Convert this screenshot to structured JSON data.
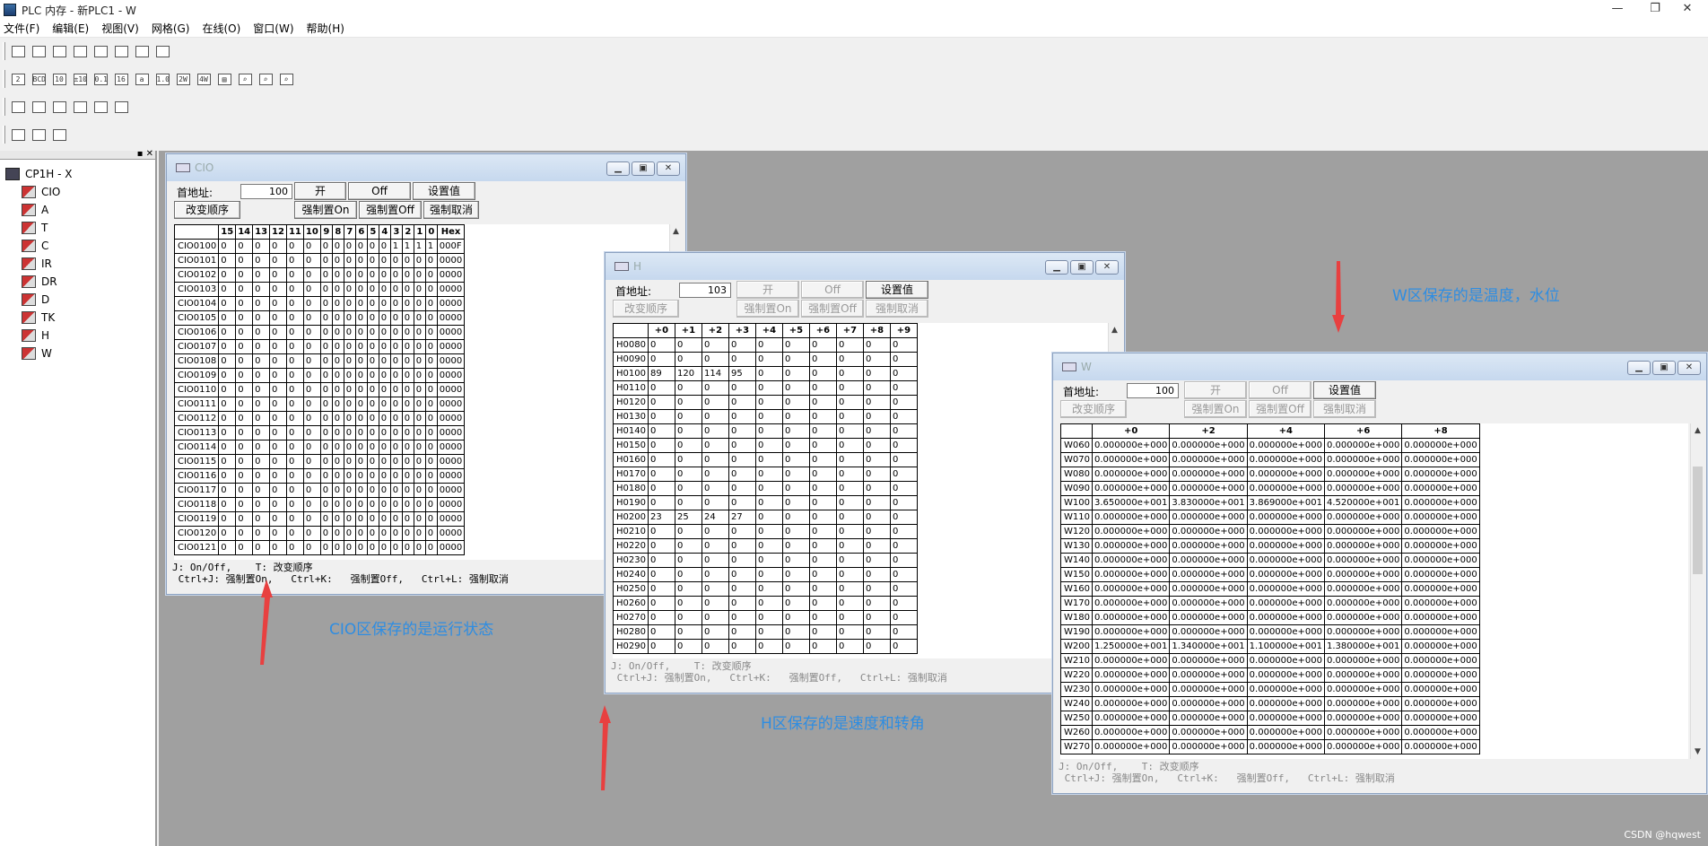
{
  "app": {
    "title": "PLC 内存 - 新PLC1 - W",
    "min": "—",
    "max": "❐",
    "close": "✕"
  },
  "menu": [
    "文件(F)",
    "编辑(E)",
    "视图(V)",
    "网格(G)",
    "在线(O)",
    "窗口(W)",
    "帮助(H)"
  ],
  "toolbar1": [
    "new-window-icon",
    "open-icon",
    "save-icon",
    "print-icon",
    "print-preview-icon",
    "cut-icon",
    "copy-icon",
    "paste-icon"
  ],
  "toolbar2": [
    {
      "name": "binary-icon",
      "g": "2"
    },
    {
      "name": "bcd-icon",
      "g": "BCD"
    },
    {
      "name": "decimal-icon",
      "g": "10"
    },
    {
      "name": "signed-decimal-icon",
      "g": "±10"
    },
    {
      "name": "float-icon",
      "g": "0.10"
    },
    {
      "name": "hex-icon",
      "g": "16"
    },
    {
      "name": "ascii-icon",
      "g": "a"
    },
    {
      "name": "double-float-icon",
      "g": "1.0"
    },
    {
      "name": "two-word-icon",
      "g": "2W"
    },
    {
      "name": "four-word-icon",
      "g": "4W"
    },
    {
      "name": "bar-icon",
      "g": "▤"
    },
    {
      "name": "find-icon",
      "g": "⌕"
    },
    {
      "name": "zoom-in-icon",
      "g": "⌕"
    },
    {
      "name": "zoom-icon",
      "g": "⌕"
    }
  ],
  "toolbar3": [
    "monitor-icon",
    "transfer-icon",
    "compare-icon",
    "upload-icon",
    "download-icon",
    "online-icon"
  ],
  "toolbar4": [
    "delete-icon",
    "force-icon",
    "clear-force-icon"
  ],
  "tree": {
    "root": "CP1H - X",
    "items": [
      "CIO",
      "A",
      "T",
      "C",
      "IR",
      "DR",
      "D",
      "TK",
      "H",
      "W"
    ]
  },
  "cio": {
    "title": "CIO",
    "addr_label": "首地址:",
    "addr_value": "100",
    "btn_on": "开",
    "btn_off": "Off",
    "btn_set": "设置值",
    "btn_order": "改变顺序",
    "btn_force_on": "强制置On",
    "btn_force_off": "强制置Off",
    "btn_force_cancel": "强制取消",
    "headers": [
      "",
      "15",
      "14",
      "13",
      "12",
      "11",
      "10",
      "9",
      "8",
      "7",
      "6",
      "5",
      "4",
      "3",
      "2",
      "1",
      "0",
      "Hex"
    ],
    "rows": [
      [
        "CIO0100",
        "0",
        "0",
        "0",
        "0",
        "0",
        "0",
        "0",
        "0",
        "0",
        "0",
        "0",
        "0",
        "1",
        "1",
        "1",
        "1",
        "000F"
      ],
      [
        "CIO0101",
        "0",
        "0",
        "0",
        "0",
        "0",
        "0",
        "0",
        "0",
        "0",
        "0",
        "0",
        "0",
        "0",
        "0",
        "0",
        "0",
        "0000"
      ],
      [
        "CIO0102",
        "0",
        "0",
        "0",
        "0",
        "0",
        "0",
        "0",
        "0",
        "0",
        "0",
        "0",
        "0",
        "0",
        "0",
        "0",
        "0",
        "0000"
      ],
      [
        "CIO0103",
        "0",
        "0",
        "0",
        "0",
        "0",
        "0",
        "0",
        "0",
        "0",
        "0",
        "0",
        "0",
        "0",
        "0",
        "0",
        "0",
        "0000"
      ],
      [
        "CIO0104",
        "0",
        "0",
        "0",
        "0",
        "0",
        "0",
        "0",
        "0",
        "0",
        "0",
        "0",
        "0",
        "0",
        "0",
        "0",
        "0",
        "0000"
      ],
      [
        "CIO0105",
        "0",
        "0",
        "0",
        "0",
        "0",
        "0",
        "0",
        "0",
        "0",
        "0",
        "0",
        "0",
        "0",
        "0",
        "0",
        "0",
        "0000"
      ],
      [
        "CIO0106",
        "0",
        "0",
        "0",
        "0",
        "0",
        "0",
        "0",
        "0",
        "0",
        "0",
        "0",
        "0",
        "0",
        "0",
        "0",
        "0",
        "0000"
      ],
      [
        "CIO0107",
        "0",
        "0",
        "0",
        "0",
        "0",
        "0",
        "0",
        "0",
        "0",
        "0",
        "0",
        "0",
        "0",
        "0",
        "0",
        "0",
        "0000"
      ],
      [
        "CIO0108",
        "0",
        "0",
        "0",
        "0",
        "0",
        "0",
        "0",
        "0",
        "0",
        "0",
        "0",
        "0",
        "0",
        "0",
        "0",
        "0",
        "0000"
      ],
      [
        "CIO0109",
        "0",
        "0",
        "0",
        "0",
        "0",
        "0",
        "0",
        "0",
        "0",
        "0",
        "0",
        "0",
        "0",
        "0",
        "0",
        "0",
        "0000"
      ],
      [
        "CIO0110",
        "0",
        "0",
        "0",
        "0",
        "0",
        "0",
        "0",
        "0",
        "0",
        "0",
        "0",
        "0",
        "0",
        "0",
        "0",
        "0",
        "0000"
      ],
      [
        "CIO0111",
        "0",
        "0",
        "0",
        "0",
        "0",
        "0",
        "0",
        "0",
        "0",
        "0",
        "0",
        "0",
        "0",
        "0",
        "0",
        "0",
        "0000"
      ],
      [
        "CIO0112",
        "0",
        "0",
        "0",
        "0",
        "0",
        "0",
        "0",
        "0",
        "0",
        "0",
        "0",
        "0",
        "0",
        "0",
        "0",
        "0",
        "0000"
      ],
      [
        "CIO0113",
        "0",
        "0",
        "0",
        "0",
        "0",
        "0",
        "0",
        "0",
        "0",
        "0",
        "0",
        "0",
        "0",
        "0",
        "0",
        "0",
        "0000"
      ],
      [
        "CIO0114",
        "0",
        "0",
        "0",
        "0",
        "0",
        "0",
        "0",
        "0",
        "0",
        "0",
        "0",
        "0",
        "0",
        "0",
        "0",
        "0",
        "0000"
      ],
      [
        "CIO0115",
        "0",
        "0",
        "0",
        "0",
        "0",
        "0",
        "0",
        "0",
        "0",
        "0",
        "0",
        "0",
        "0",
        "0",
        "0",
        "0",
        "0000"
      ],
      [
        "CIO0116",
        "0",
        "0",
        "0",
        "0",
        "0",
        "0",
        "0",
        "0",
        "0",
        "0",
        "0",
        "0",
        "0",
        "0",
        "0",
        "0",
        "0000"
      ],
      [
        "CIO0117",
        "0",
        "0",
        "0",
        "0",
        "0",
        "0",
        "0",
        "0",
        "0",
        "0",
        "0",
        "0",
        "0",
        "0",
        "0",
        "0",
        "0000"
      ],
      [
        "CIO0118",
        "0",
        "0",
        "0",
        "0",
        "0",
        "0",
        "0",
        "0",
        "0",
        "0",
        "0",
        "0",
        "0",
        "0",
        "0",
        "0",
        "0000"
      ],
      [
        "CIO0119",
        "0",
        "0",
        "0",
        "0",
        "0",
        "0",
        "0",
        "0",
        "0",
        "0",
        "0",
        "0",
        "0",
        "0",
        "0",
        "0",
        "0000"
      ],
      [
        "CIO0120",
        "0",
        "0",
        "0",
        "0",
        "0",
        "0",
        "0",
        "0",
        "0",
        "0",
        "0",
        "0",
        "0",
        "0",
        "0",
        "0",
        "0000"
      ],
      [
        "CIO0121",
        "0",
        "0",
        "0",
        "0",
        "0",
        "0",
        "0",
        "0",
        "0",
        "0",
        "0",
        "0",
        "0",
        "0",
        "0",
        "0",
        "0000"
      ]
    ],
    "status1": "J: On/Off,    T: 改变顺序",
    "status2": " Ctrl+J: 强制置On,   Ctrl+K:   强制置Off,   Ctrl+L: 强制取消"
  },
  "h": {
    "title": "H",
    "addr_label": "首地址:",
    "addr_value": "103",
    "btn_on": "开",
    "btn_off": "Off",
    "btn_set": "设置值",
    "btn_order": "改变顺序",
    "btn_force_on": "强制置On",
    "btn_force_off": "强制置Off",
    "btn_force_cancel": "强制取消",
    "headers": [
      "",
      "+0",
      "+1",
      "+2",
      "+3",
      "+4",
      "+5",
      "+6",
      "+7",
      "+8",
      "+9"
    ],
    "rows": [
      [
        "H0080",
        "0",
        "0",
        "0",
        "0",
        "0",
        "0",
        "0",
        "0",
        "0",
        "0"
      ],
      [
        "H0090",
        "0",
        "0",
        "0",
        "0",
        "0",
        "0",
        "0",
        "0",
        "0",
        "0"
      ],
      [
        "H0100",
        "89",
        "120",
        "114",
        "95",
        "0",
        "0",
        "0",
        "0",
        "0",
        "0"
      ],
      [
        "H0110",
        "0",
        "0",
        "0",
        "0",
        "0",
        "0",
        "0",
        "0",
        "0",
        "0"
      ],
      [
        "H0120",
        "0",
        "0",
        "0",
        "0",
        "0",
        "0",
        "0",
        "0",
        "0",
        "0"
      ],
      [
        "H0130",
        "0",
        "0",
        "0",
        "0",
        "0",
        "0",
        "0",
        "0",
        "0",
        "0"
      ],
      [
        "H0140",
        "0",
        "0",
        "0",
        "0",
        "0",
        "0",
        "0",
        "0",
        "0",
        "0"
      ],
      [
        "H0150",
        "0",
        "0",
        "0",
        "0",
        "0",
        "0",
        "0",
        "0",
        "0",
        "0"
      ],
      [
        "H0160",
        "0",
        "0",
        "0",
        "0",
        "0",
        "0",
        "0",
        "0",
        "0",
        "0"
      ],
      [
        "H0170",
        "0",
        "0",
        "0",
        "0",
        "0",
        "0",
        "0",
        "0",
        "0",
        "0"
      ],
      [
        "H0180",
        "0",
        "0",
        "0",
        "0",
        "0",
        "0",
        "0",
        "0",
        "0",
        "0"
      ],
      [
        "H0190",
        "0",
        "0",
        "0",
        "0",
        "0",
        "0",
        "0",
        "0",
        "0",
        "0"
      ],
      [
        "H0200",
        "23",
        "25",
        "24",
        "27",
        "0",
        "0",
        "0",
        "0",
        "0",
        "0"
      ],
      [
        "H0210",
        "0",
        "0",
        "0",
        "0",
        "0",
        "0",
        "0",
        "0",
        "0",
        "0"
      ],
      [
        "H0220",
        "0",
        "0",
        "0",
        "0",
        "0",
        "0",
        "0",
        "0",
        "0",
        "0"
      ],
      [
        "H0230",
        "0",
        "0",
        "0",
        "0",
        "0",
        "0",
        "0",
        "0",
        "0",
        "0"
      ],
      [
        "H0240",
        "0",
        "0",
        "0",
        "0",
        "0",
        "0",
        "0",
        "0",
        "0",
        "0"
      ],
      [
        "H0250",
        "0",
        "0",
        "0",
        "0",
        "0",
        "0",
        "0",
        "0",
        "0",
        "0"
      ],
      [
        "H0260",
        "0",
        "0",
        "0",
        "0",
        "0",
        "0",
        "0",
        "0",
        "0",
        "0"
      ],
      [
        "H0270",
        "0",
        "0",
        "0",
        "0",
        "0",
        "0",
        "0",
        "0",
        "0",
        "0"
      ],
      [
        "H0280",
        "0",
        "0",
        "0",
        "0",
        "0",
        "0",
        "0",
        "0",
        "0",
        "0"
      ],
      [
        "H0290",
        "0",
        "0",
        "0",
        "0",
        "0",
        "0",
        "0",
        "0",
        "0",
        "0"
      ]
    ],
    "status1": "J: On/Off,    T: 改变顺序",
    "status2": " Ctrl+J: 强制置On,   Ctrl+K:   强制置Off,   Ctrl+L: 强制取消"
  },
  "w": {
    "title": "W",
    "addr_label": "首地址:",
    "addr_value": "100",
    "btn_on": "开",
    "btn_off": "Off",
    "btn_set": "设置值",
    "btn_order": "改变顺序",
    "btn_force_on": "强制置On",
    "btn_force_off": "强制置Off",
    "btn_force_cancel": "强制取消",
    "headers": [
      "",
      "+0",
      "+2",
      "+4",
      "+6",
      "+8"
    ],
    "rows": [
      [
        "W060",
        "0.000000e+000",
        "0.000000e+000",
        "0.000000e+000",
        "0.000000e+000",
        "0.000000e+000"
      ],
      [
        "W070",
        "0.000000e+000",
        "0.000000e+000",
        "0.000000e+000",
        "0.000000e+000",
        "0.000000e+000"
      ],
      [
        "W080",
        "0.000000e+000",
        "0.000000e+000",
        "0.000000e+000",
        "0.000000e+000",
        "0.000000e+000"
      ],
      [
        "W090",
        "0.000000e+000",
        "0.000000e+000",
        "0.000000e+000",
        "0.000000e+000",
        "0.000000e+000"
      ],
      [
        "W100",
        "3.650000e+001",
        "3.830000e+001",
        "3.869000e+001",
        "4.520000e+001",
        "0.000000e+000"
      ],
      [
        "W110",
        "0.000000e+000",
        "0.000000e+000",
        "0.000000e+000",
        "0.000000e+000",
        "0.000000e+000"
      ],
      [
        "W120",
        "0.000000e+000",
        "0.000000e+000",
        "0.000000e+000",
        "0.000000e+000",
        "0.000000e+000"
      ],
      [
        "W130",
        "0.000000e+000",
        "0.000000e+000",
        "0.000000e+000",
        "0.000000e+000",
        "0.000000e+000"
      ],
      [
        "W140",
        "0.000000e+000",
        "0.000000e+000",
        "0.000000e+000",
        "0.000000e+000",
        "0.000000e+000"
      ],
      [
        "W150",
        "0.000000e+000",
        "0.000000e+000",
        "0.000000e+000",
        "0.000000e+000",
        "0.000000e+000"
      ],
      [
        "W160",
        "0.000000e+000",
        "0.000000e+000",
        "0.000000e+000",
        "0.000000e+000",
        "0.000000e+000"
      ],
      [
        "W170",
        "0.000000e+000",
        "0.000000e+000",
        "0.000000e+000",
        "0.000000e+000",
        "0.000000e+000"
      ],
      [
        "W180",
        "0.000000e+000",
        "0.000000e+000",
        "0.000000e+000",
        "0.000000e+000",
        "0.000000e+000"
      ],
      [
        "W190",
        "0.000000e+000",
        "0.000000e+000",
        "0.000000e+000",
        "0.000000e+000",
        "0.000000e+000"
      ],
      [
        "W200",
        "1.250000e+001",
        "1.340000e+001",
        "1.100000e+001",
        "1.380000e+001",
        "0.000000e+000"
      ],
      [
        "W210",
        "0.000000e+000",
        "0.000000e+000",
        "0.000000e+000",
        "0.000000e+000",
        "0.000000e+000"
      ],
      [
        "W220",
        "0.000000e+000",
        "0.000000e+000",
        "0.000000e+000",
        "0.000000e+000",
        "0.000000e+000"
      ],
      [
        "W230",
        "0.000000e+000",
        "0.000000e+000",
        "0.000000e+000",
        "0.000000e+000",
        "0.000000e+000"
      ],
      [
        "W240",
        "0.000000e+000",
        "0.000000e+000",
        "0.000000e+000",
        "0.000000e+000",
        "0.000000e+000"
      ],
      [
        "W250",
        "0.000000e+000",
        "0.000000e+000",
        "0.000000e+000",
        "0.000000e+000",
        "0.000000e+000"
      ],
      [
        "W260",
        "0.000000e+000",
        "0.000000e+000",
        "0.000000e+000",
        "0.000000e+000",
        "0.000000e+000"
      ],
      [
        "W270",
        "0.000000e+000",
        "0.000000e+000",
        "0.000000e+000",
        "0.000000e+000",
        "0.000000e+000"
      ]
    ],
    "status1": "J: On/Off,    T: 改变顺序",
    "status2": " Ctrl+J: 强制置On,   Ctrl+K:   强制置Off,   Ctrl+L: 强制取消"
  },
  "annotations": {
    "cio": "CIO区保存的是运行状态",
    "h": "H区保存的是速度和转角",
    "w": "W区保存的是温度，水位"
  },
  "watermark": "CSDN @hqwest",
  "colors": {
    "annotation": "#2e8de2",
    "arrow": "#e84040",
    "mdi_bg": "#a0a0a0"
  }
}
